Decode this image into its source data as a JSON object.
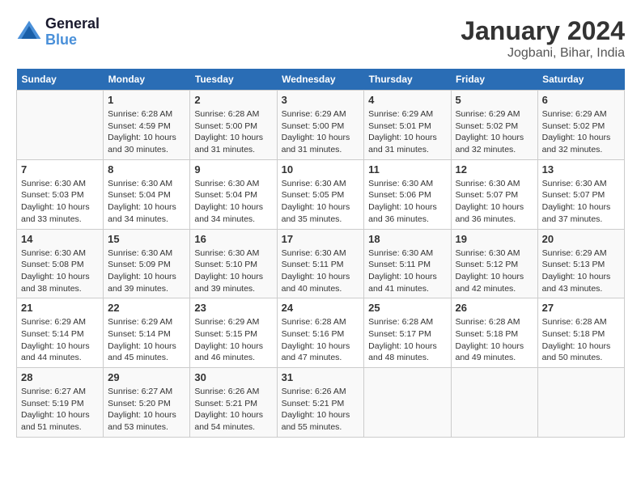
{
  "logo": {
    "text_general": "General",
    "text_blue": "Blue"
  },
  "title": "January 2024",
  "subtitle": "Jogbani, Bihar, India",
  "header_days": [
    "Sunday",
    "Monday",
    "Tuesday",
    "Wednesday",
    "Thursday",
    "Friday",
    "Saturday"
  ],
  "weeks": [
    [
      {
        "day": "",
        "info": ""
      },
      {
        "day": "1",
        "info": "Sunrise: 6:28 AM\nSunset: 4:59 PM\nDaylight: 10 hours\nand 30 minutes."
      },
      {
        "day": "2",
        "info": "Sunrise: 6:28 AM\nSunset: 5:00 PM\nDaylight: 10 hours\nand 31 minutes."
      },
      {
        "day": "3",
        "info": "Sunrise: 6:29 AM\nSunset: 5:00 PM\nDaylight: 10 hours\nand 31 minutes."
      },
      {
        "day": "4",
        "info": "Sunrise: 6:29 AM\nSunset: 5:01 PM\nDaylight: 10 hours\nand 31 minutes."
      },
      {
        "day": "5",
        "info": "Sunrise: 6:29 AM\nSunset: 5:02 PM\nDaylight: 10 hours\nand 32 minutes."
      },
      {
        "day": "6",
        "info": "Sunrise: 6:29 AM\nSunset: 5:02 PM\nDaylight: 10 hours\nand 32 minutes."
      }
    ],
    [
      {
        "day": "7",
        "info": "Sunrise: 6:30 AM\nSunset: 5:03 PM\nDaylight: 10 hours\nand 33 minutes."
      },
      {
        "day": "8",
        "info": "Sunrise: 6:30 AM\nSunset: 5:04 PM\nDaylight: 10 hours\nand 34 minutes."
      },
      {
        "day": "9",
        "info": "Sunrise: 6:30 AM\nSunset: 5:04 PM\nDaylight: 10 hours\nand 34 minutes."
      },
      {
        "day": "10",
        "info": "Sunrise: 6:30 AM\nSunset: 5:05 PM\nDaylight: 10 hours\nand 35 minutes."
      },
      {
        "day": "11",
        "info": "Sunrise: 6:30 AM\nSunset: 5:06 PM\nDaylight: 10 hours\nand 36 minutes."
      },
      {
        "day": "12",
        "info": "Sunrise: 6:30 AM\nSunset: 5:07 PM\nDaylight: 10 hours\nand 36 minutes."
      },
      {
        "day": "13",
        "info": "Sunrise: 6:30 AM\nSunset: 5:07 PM\nDaylight: 10 hours\nand 37 minutes."
      }
    ],
    [
      {
        "day": "14",
        "info": "Sunrise: 6:30 AM\nSunset: 5:08 PM\nDaylight: 10 hours\nand 38 minutes."
      },
      {
        "day": "15",
        "info": "Sunrise: 6:30 AM\nSunset: 5:09 PM\nDaylight: 10 hours\nand 39 minutes."
      },
      {
        "day": "16",
        "info": "Sunrise: 6:30 AM\nSunset: 5:10 PM\nDaylight: 10 hours\nand 39 minutes."
      },
      {
        "day": "17",
        "info": "Sunrise: 6:30 AM\nSunset: 5:11 PM\nDaylight: 10 hours\nand 40 minutes."
      },
      {
        "day": "18",
        "info": "Sunrise: 6:30 AM\nSunset: 5:11 PM\nDaylight: 10 hours\nand 41 minutes."
      },
      {
        "day": "19",
        "info": "Sunrise: 6:30 AM\nSunset: 5:12 PM\nDaylight: 10 hours\nand 42 minutes."
      },
      {
        "day": "20",
        "info": "Sunrise: 6:29 AM\nSunset: 5:13 PM\nDaylight: 10 hours\nand 43 minutes."
      }
    ],
    [
      {
        "day": "21",
        "info": "Sunrise: 6:29 AM\nSunset: 5:14 PM\nDaylight: 10 hours\nand 44 minutes."
      },
      {
        "day": "22",
        "info": "Sunrise: 6:29 AM\nSunset: 5:14 PM\nDaylight: 10 hours\nand 45 minutes."
      },
      {
        "day": "23",
        "info": "Sunrise: 6:29 AM\nSunset: 5:15 PM\nDaylight: 10 hours\nand 46 minutes."
      },
      {
        "day": "24",
        "info": "Sunrise: 6:28 AM\nSunset: 5:16 PM\nDaylight: 10 hours\nand 47 minutes."
      },
      {
        "day": "25",
        "info": "Sunrise: 6:28 AM\nSunset: 5:17 PM\nDaylight: 10 hours\nand 48 minutes."
      },
      {
        "day": "26",
        "info": "Sunrise: 6:28 AM\nSunset: 5:18 PM\nDaylight: 10 hours\nand 49 minutes."
      },
      {
        "day": "27",
        "info": "Sunrise: 6:28 AM\nSunset: 5:18 PM\nDaylight: 10 hours\nand 50 minutes."
      }
    ],
    [
      {
        "day": "28",
        "info": "Sunrise: 6:27 AM\nSunset: 5:19 PM\nDaylight: 10 hours\nand 51 minutes."
      },
      {
        "day": "29",
        "info": "Sunrise: 6:27 AM\nSunset: 5:20 PM\nDaylight: 10 hours\nand 53 minutes."
      },
      {
        "day": "30",
        "info": "Sunrise: 6:26 AM\nSunset: 5:21 PM\nDaylight: 10 hours\nand 54 minutes."
      },
      {
        "day": "31",
        "info": "Sunrise: 6:26 AM\nSunset: 5:21 PM\nDaylight: 10 hours\nand 55 minutes."
      },
      {
        "day": "",
        "info": ""
      },
      {
        "day": "",
        "info": ""
      },
      {
        "day": "",
        "info": ""
      }
    ]
  ]
}
